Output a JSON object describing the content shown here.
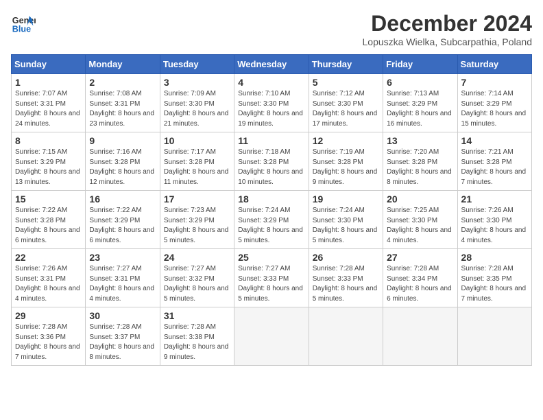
{
  "logo": {
    "line1": "General",
    "line2": "Blue"
  },
  "title": "December 2024",
  "location": "Lopuszka Wielka, Subcarpathia, Poland",
  "headers": [
    "Sunday",
    "Monday",
    "Tuesday",
    "Wednesday",
    "Thursday",
    "Friday",
    "Saturday"
  ],
  "weeks": [
    [
      {
        "day": "1",
        "sunrise": "Sunrise: 7:07 AM",
        "sunset": "Sunset: 3:31 PM",
        "daylight": "Daylight: 8 hours and 24 minutes."
      },
      {
        "day": "2",
        "sunrise": "Sunrise: 7:08 AM",
        "sunset": "Sunset: 3:31 PM",
        "daylight": "Daylight: 8 hours and 23 minutes."
      },
      {
        "day": "3",
        "sunrise": "Sunrise: 7:09 AM",
        "sunset": "Sunset: 3:30 PM",
        "daylight": "Daylight: 8 hours and 21 minutes."
      },
      {
        "day": "4",
        "sunrise": "Sunrise: 7:10 AM",
        "sunset": "Sunset: 3:30 PM",
        "daylight": "Daylight: 8 hours and 19 minutes."
      },
      {
        "day": "5",
        "sunrise": "Sunrise: 7:12 AM",
        "sunset": "Sunset: 3:30 PM",
        "daylight": "Daylight: 8 hours and 17 minutes."
      },
      {
        "day": "6",
        "sunrise": "Sunrise: 7:13 AM",
        "sunset": "Sunset: 3:29 PM",
        "daylight": "Daylight: 8 hours and 16 minutes."
      },
      {
        "day": "7",
        "sunrise": "Sunrise: 7:14 AM",
        "sunset": "Sunset: 3:29 PM",
        "daylight": "Daylight: 8 hours and 15 minutes."
      }
    ],
    [
      {
        "day": "8",
        "sunrise": "Sunrise: 7:15 AM",
        "sunset": "Sunset: 3:29 PM",
        "daylight": "Daylight: 8 hours and 13 minutes."
      },
      {
        "day": "9",
        "sunrise": "Sunrise: 7:16 AM",
        "sunset": "Sunset: 3:28 PM",
        "daylight": "Daylight: 8 hours and 12 minutes."
      },
      {
        "day": "10",
        "sunrise": "Sunrise: 7:17 AM",
        "sunset": "Sunset: 3:28 PM",
        "daylight": "Daylight: 8 hours and 11 minutes."
      },
      {
        "day": "11",
        "sunrise": "Sunrise: 7:18 AM",
        "sunset": "Sunset: 3:28 PM",
        "daylight": "Daylight: 8 hours and 10 minutes."
      },
      {
        "day": "12",
        "sunrise": "Sunrise: 7:19 AM",
        "sunset": "Sunset: 3:28 PM",
        "daylight": "Daylight: 8 hours and 9 minutes."
      },
      {
        "day": "13",
        "sunrise": "Sunrise: 7:20 AM",
        "sunset": "Sunset: 3:28 PM",
        "daylight": "Daylight: 8 hours and 8 minutes."
      },
      {
        "day": "14",
        "sunrise": "Sunrise: 7:21 AM",
        "sunset": "Sunset: 3:28 PM",
        "daylight": "Daylight: 8 hours and 7 minutes."
      }
    ],
    [
      {
        "day": "15",
        "sunrise": "Sunrise: 7:22 AM",
        "sunset": "Sunset: 3:28 PM",
        "daylight": "Daylight: 8 hours and 6 minutes."
      },
      {
        "day": "16",
        "sunrise": "Sunrise: 7:22 AM",
        "sunset": "Sunset: 3:29 PM",
        "daylight": "Daylight: 8 hours and 6 minutes."
      },
      {
        "day": "17",
        "sunrise": "Sunrise: 7:23 AM",
        "sunset": "Sunset: 3:29 PM",
        "daylight": "Daylight: 8 hours and 5 minutes."
      },
      {
        "day": "18",
        "sunrise": "Sunrise: 7:24 AM",
        "sunset": "Sunset: 3:29 PM",
        "daylight": "Daylight: 8 hours and 5 minutes."
      },
      {
        "day": "19",
        "sunrise": "Sunrise: 7:24 AM",
        "sunset": "Sunset: 3:30 PM",
        "daylight": "Daylight: 8 hours and 5 minutes."
      },
      {
        "day": "20",
        "sunrise": "Sunrise: 7:25 AM",
        "sunset": "Sunset: 3:30 PM",
        "daylight": "Daylight: 8 hours and 4 minutes."
      },
      {
        "day": "21",
        "sunrise": "Sunrise: 7:26 AM",
        "sunset": "Sunset: 3:30 PM",
        "daylight": "Daylight: 8 hours and 4 minutes."
      }
    ],
    [
      {
        "day": "22",
        "sunrise": "Sunrise: 7:26 AM",
        "sunset": "Sunset: 3:31 PM",
        "daylight": "Daylight: 8 hours and 4 minutes."
      },
      {
        "day": "23",
        "sunrise": "Sunrise: 7:27 AM",
        "sunset": "Sunset: 3:31 PM",
        "daylight": "Daylight: 8 hours and 4 minutes."
      },
      {
        "day": "24",
        "sunrise": "Sunrise: 7:27 AM",
        "sunset": "Sunset: 3:32 PM",
        "daylight": "Daylight: 8 hours and 5 minutes."
      },
      {
        "day": "25",
        "sunrise": "Sunrise: 7:27 AM",
        "sunset": "Sunset: 3:33 PM",
        "daylight": "Daylight: 8 hours and 5 minutes."
      },
      {
        "day": "26",
        "sunrise": "Sunrise: 7:28 AM",
        "sunset": "Sunset: 3:33 PM",
        "daylight": "Daylight: 8 hours and 5 minutes."
      },
      {
        "day": "27",
        "sunrise": "Sunrise: 7:28 AM",
        "sunset": "Sunset: 3:34 PM",
        "daylight": "Daylight: 8 hours and 6 minutes."
      },
      {
        "day": "28",
        "sunrise": "Sunrise: 7:28 AM",
        "sunset": "Sunset: 3:35 PM",
        "daylight": "Daylight: 8 hours and 7 minutes."
      }
    ],
    [
      {
        "day": "29",
        "sunrise": "Sunrise: 7:28 AM",
        "sunset": "Sunset: 3:36 PM",
        "daylight": "Daylight: 8 hours and 7 minutes."
      },
      {
        "day": "30",
        "sunrise": "Sunrise: 7:28 AM",
        "sunset": "Sunset: 3:37 PM",
        "daylight": "Daylight: 8 hours and 8 minutes."
      },
      {
        "day": "31",
        "sunrise": "Sunrise: 7:28 AM",
        "sunset": "Sunset: 3:38 PM",
        "daylight": "Daylight: 8 hours and 9 minutes."
      },
      null,
      null,
      null,
      null
    ]
  ]
}
